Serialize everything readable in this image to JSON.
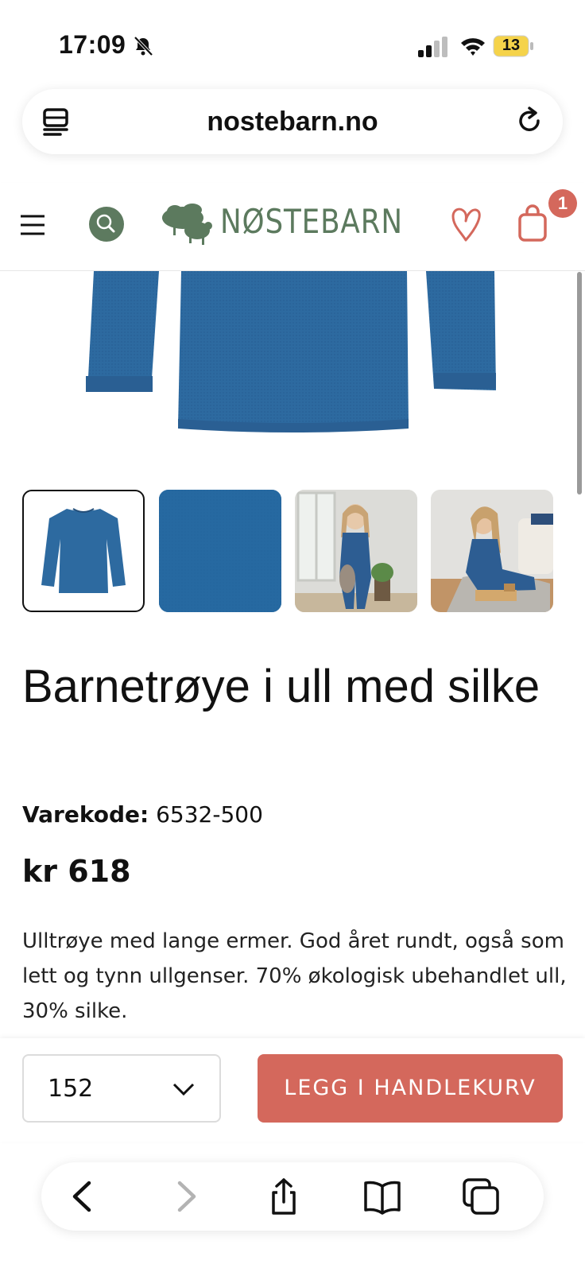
{
  "status_bar": {
    "time": "17:09",
    "battery": "13"
  },
  "browser": {
    "url": "nostebarn.no"
  },
  "site_header": {
    "brand": "NØSTEBARN",
    "cart_count": "1"
  },
  "product": {
    "title": "Barnetrøye i ull med silke",
    "code_label": "Varekode:",
    "code_value": "6532-500",
    "price": "kr 618",
    "description": "Ulltrøye med lange ermer. God året rundt, også som lett og tynn ullgenser. 70% økologisk ubehandlet ull, 30% silke.",
    "thumbnails": [
      "sweater-front",
      "fabric-closeup",
      "child-standing",
      "child-playing"
    ]
  },
  "buy_bar": {
    "size_selected": "152",
    "add_to_cart_label": "LEGG I HANDLEKURV"
  },
  "colors": {
    "accent": "#d4685c",
    "brand_green": "#5c7a5e",
    "product_blue": "#2d6aa0"
  }
}
